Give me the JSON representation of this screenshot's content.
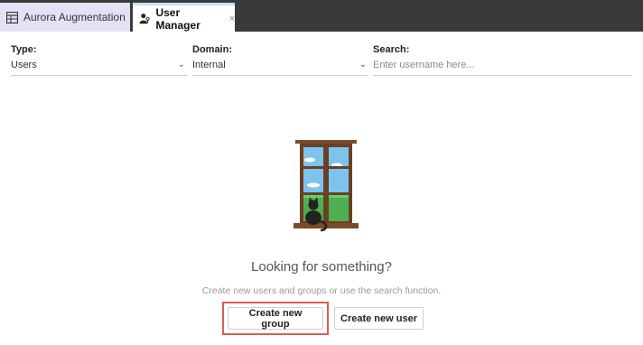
{
  "tabs": [
    {
      "label": "Aurora Augmentation",
      "icon": "table-icon",
      "active": false
    },
    {
      "label": "User Manager",
      "icon": "user-key-icon",
      "active": true,
      "close": "×"
    }
  ],
  "filters": {
    "type": {
      "label": "Type:",
      "value": "Users"
    },
    "domain": {
      "label": "Domain:",
      "value": "Internal"
    },
    "search": {
      "label": "Search:",
      "placeholder": "Enter username here..."
    }
  },
  "empty_state": {
    "heading": "Looking for something?",
    "subtext": "Create new users and groups or use the search function."
  },
  "buttons": {
    "create_group": "Create new group",
    "create_user": "Create new user"
  },
  "colors": {
    "tab_inactive_bg": "#e6e0f5",
    "tabbar_bg": "#3a3a3a",
    "highlight_border": "#e05a52"
  }
}
